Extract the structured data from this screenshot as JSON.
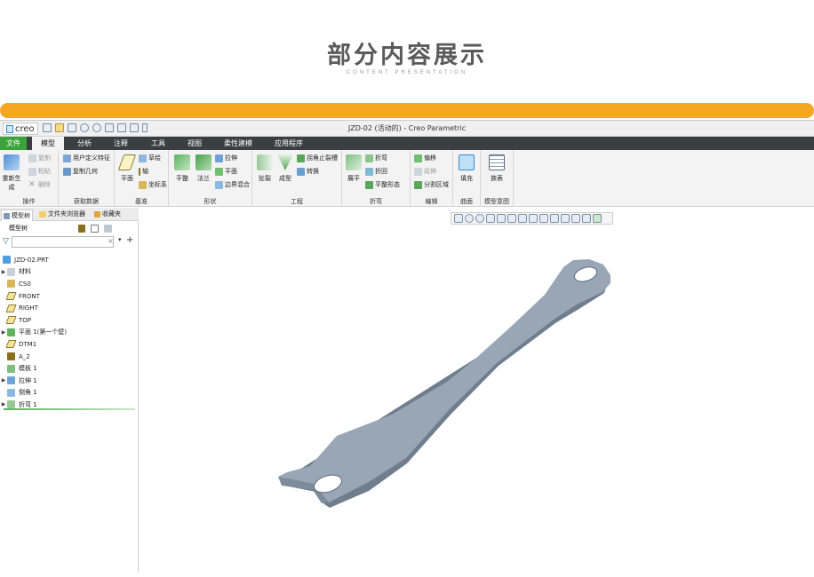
{
  "hero": {
    "title": "部分内容展示",
    "subtitle": "CONTENT PRESENTATION"
  },
  "colors": {
    "accent_bar": "#f5a623",
    "file_tab": "#3aa43a",
    "tab_bar": "#3a3f42",
    "part": "#97a5b4"
  },
  "app": {
    "logo": "creo",
    "window_title": "JZD-02 (活动的) - Creo Parametric"
  },
  "tabs": [
    {
      "label": "文件"
    },
    {
      "label": "模型"
    },
    {
      "label": "分析"
    },
    {
      "label": "注释"
    },
    {
      "label": "工具"
    },
    {
      "label": "视图"
    },
    {
      "label": "柔性建模"
    },
    {
      "label": "应用程序"
    }
  ],
  "ribbon": {
    "operations": {
      "label": "操作",
      "regen": "重新生成",
      "copy": "复制",
      "paste": "粘贴",
      "delete": "删除"
    },
    "get_data": {
      "label": "获取数据",
      "udf": "用户定义特征",
      "copy_geom": "复制几何"
    },
    "datum": {
      "label": "基准",
      "plane": "平面",
      "sketch": "草绘",
      "axis": "轴",
      "csys": "坐标系"
    },
    "shapes": {
      "label": "形状",
      "flat": "平整",
      "flange": "法兰",
      "extrude": "拉伸",
      "planar": "平面",
      "boundary_blend": "边界混合"
    },
    "engineering": {
      "label": "工程",
      "rip": "扯裂",
      "form": "成型",
      "corner_relief": "拐角止裂槽",
      "convert": "转换"
    },
    "bends": {
      "label": "折弯",
      "unbend": "展平",
      "bend": "折弯",
      "bend_back": "折回",
      "flat_state": "平整形态"
    },
    "editing": {
      "label": "编辑",
      "offset": "偏移",
      "extend": "延伸",
      "split_area": "分割区域"
    },
    "surfaces": {
      "label": "曲面",
      "fill": "填充"
    },
    "model_intent": {
      "label": "模型意图",
      "family_table": "族表"
    }
  },
  "panel": {
    "tabs": [
      "模型树",
      "文件夹浏览器",
      "收藏夹"
    ],
    "header": "模型树",
    "search_placeholder": "",
    "root": "JZD-02.PRT",
    "items": [
      {
        "label": "材料",
        "expandable": true,
        "icon": "material-icon"
      },
      {
        "label": "CS0",
        "expandable": false,
        "icon": "csys-icon"
      },
      {
        "label": "FRONT",
        "expandable": false,
        "icon": "datum-plane-icon"
      },
      {
        "label": "RIGHT",
        "expandable": false,
        "icon": "datum-plane-icon"
      },
      {
        "label": "TOP",
        "expandable": false,
        "icon": "datum-plane-icon"
      },
      {
        "label": "平面 1(第一个壁)",
        "expandable": true,
        "icon": "planar-wall-icon"
      },
      {
        "label": "DTM1",
        "expandable": false,
        "icon": "datum-plane-icon"
      },
      {
        "label": "A_2",
        "expandable": false,
        "icon": "axis-icon"
      },
      {
        "label": "模板 1",
        "expandable": false,
        "icon": "form-icon"
      },
      {
        "label": "拉伸 1",
        "expandable": true,
        "icon": "extrude-icon"
      },
      {
        "label": "倒角 1",
        "expandable": false,
        "icon": "chamfer-icon"
      },
      {
        "label": "折弯 1",
        "expandable": true,
        "icon": "bend-icon"
      }
    ]
  }
}
